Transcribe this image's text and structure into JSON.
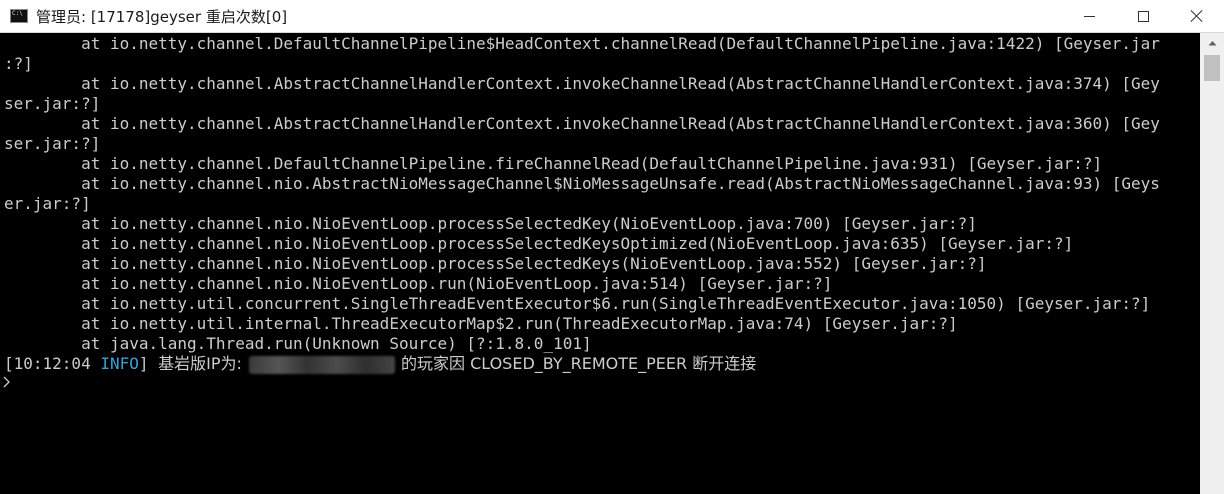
{
  "window": {
    "title": "管理员:  [17178]geyser 重启次数[0]"
  },
  "console": {
    "lines": [
      {
        "text": "        at io.netty.channel.DefaultChannelPipeline$HeadContext.channelRead(DefaultChannelPipeline.java:1422) [Geyser.jar"
      },
      {
        "text": ":?]"
      },
      {
        "text": "        at io.netty.channel.AbstractChannelHandlerContext.invokeChannelRead(AbstractChannelHandlerContext.java:374) [Gey"
      },
      {
        "text": "ser.jar:?]"
      },
      {
        "text": "        at io.netty.channel.AbstractChannelHandlerContext.invokeChannelRead(AbstractChannelHandlerContext.java:360) [Gey"
      },
      {
        "text": "ser.jar:?]"
      },
      {
        "text": "        at io.netty.channel.DefaultChannelPipeline.fireChannelRead(DefaultChannelPipeline.java:931) [Geyser.jar:?]"
      },
      {
        "text": "        at io.netty.channel.nio.AbstractNioMessageChannel$NioMessageUnsafe.read(AbstractNioMessageChannel.java:93) [Geys"
      },
      {
        "text": "er.jar:?]"
      },
      {
        "text": "        at io.netty.channel.nio.NioEventLoop.processSelectedKey(NioEventLoop.java:700) [Geyser.jar:?]"
      },
      {
        "text": "        at io.netty.channel.nio.NioEventLoop.processSelectedKeysOptimized(NioEventLoop.java:635) [Geyser.jar:?]"
      },
      {
        "text": "        at io.netty.channel.nio.NioEventLoop.processSelectedKeys(NioEventLoop.java:552) [Geyser.jar:?]"
      },
      {
        "text": "        at io.netty.channel.nio.NioEventLoop.run(NioEventLoop.java:514) [Geyser.jar:?]"
      },
      {
        "text": "        at io.netty.util.concurrent.SingleThreadEventExecutor$6.run(SingleThreadEventExecutor.java:1050) [Geyser.jar:?]"
      },
      {
        "text": "        at io.netty.util.internal.ThreadExecutorMap$2.run(ThreadExecutorMap.java:74) [Geyser.jar:?]"
      },
      {
        "text": "        at java.lang.Thread.run(Unknown Source) [?:1.8.0_101]"
      }
    ],
    "log_line": {
      "time": "[10:12:04 ",
      "level": "INFO",
      "bracket_close": "] ",
      "msg_prefix": "基岩版IP为: ",
      "msg_suffix": "的玩家因 CLOSED_BY_REMOTE_PEER 断开连接"
    }
  },
  "colors": {
    "console_bg": "#000000",
    "console_text": "#cccccc",
    "info_text": "#3aa0d8"
  }
}
